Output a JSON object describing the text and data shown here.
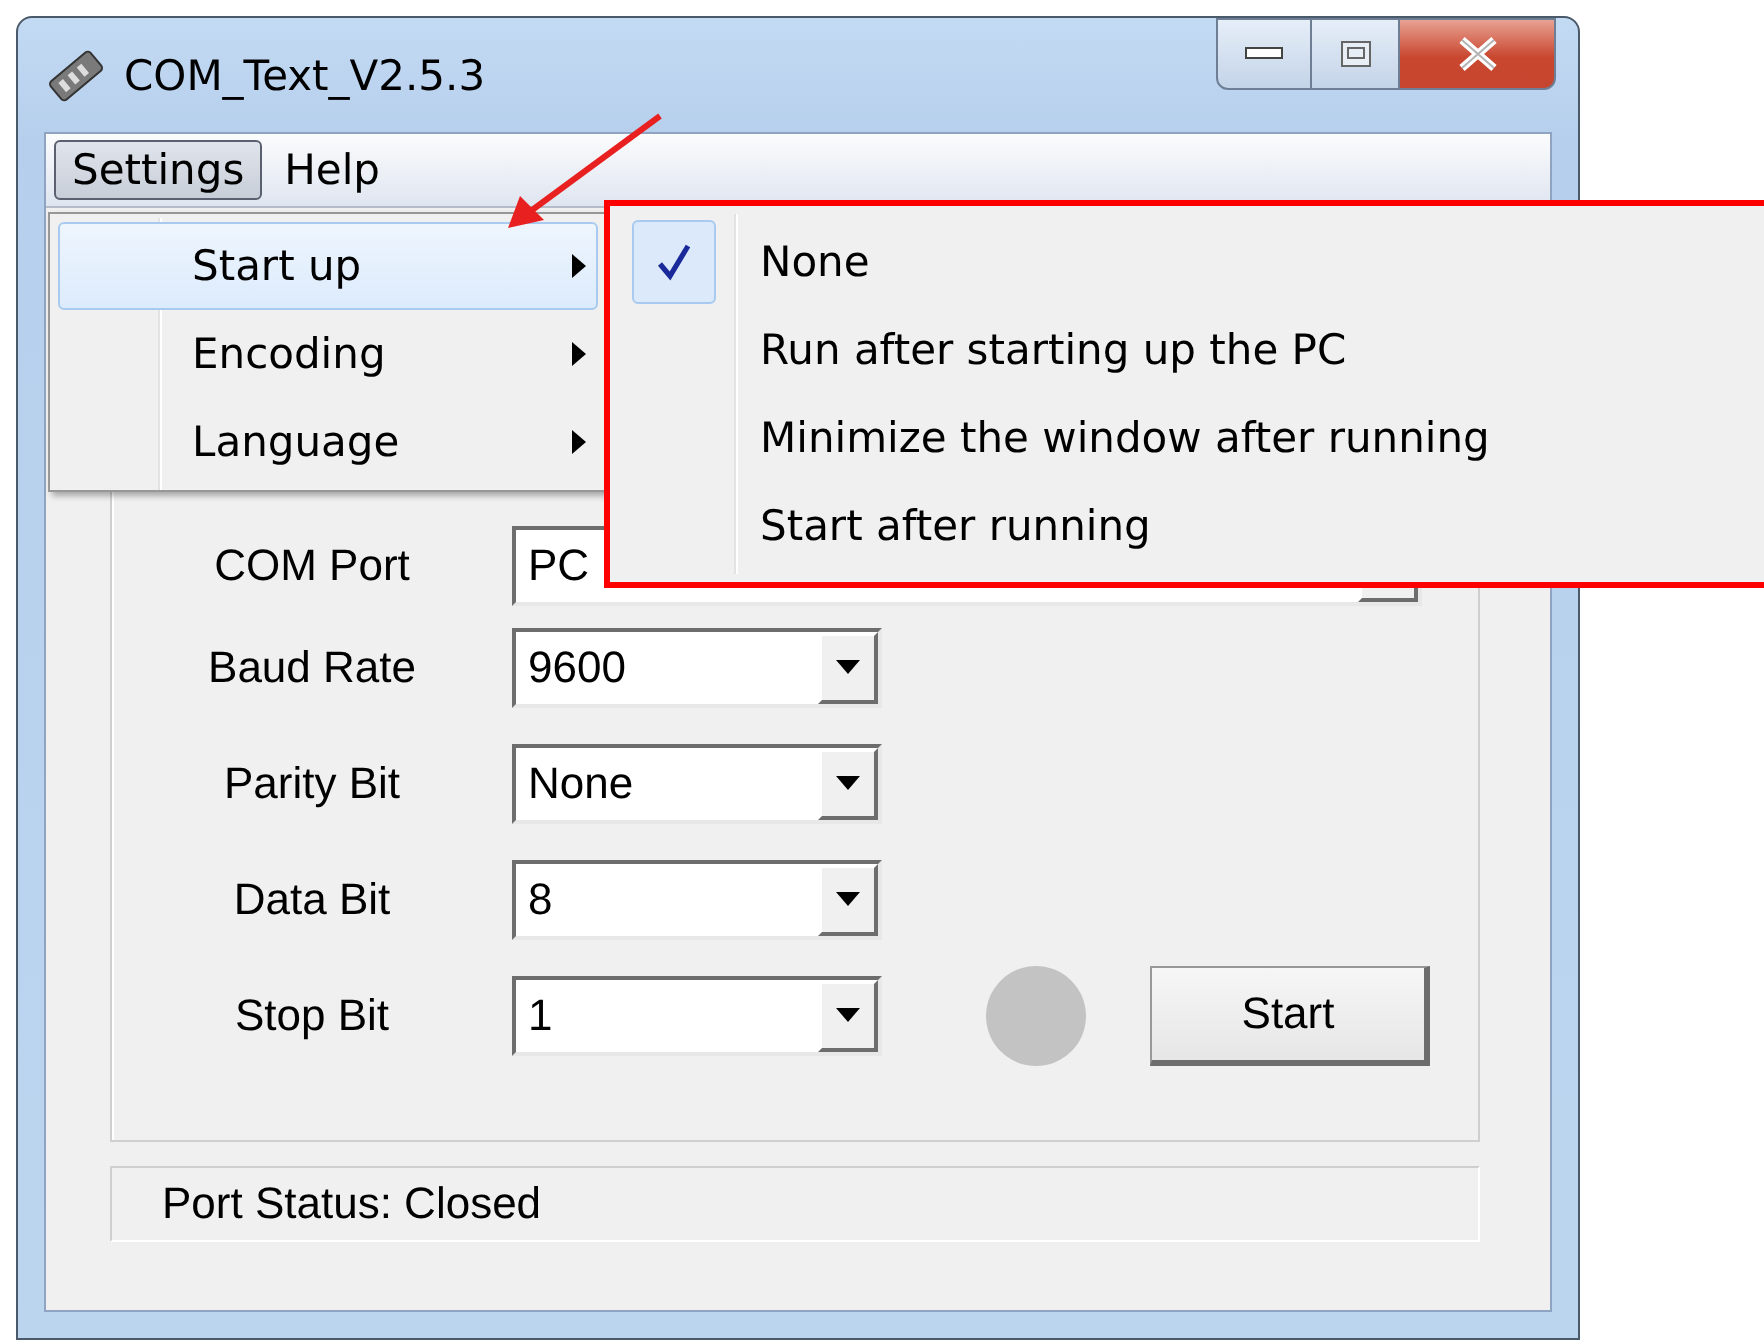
{
  "window": {
    "title": "COM_Text_V2.5.3"
  },
  "menu_bar": [
    {
      "label": "Settings",
      "selected": true
    },
    {
      "label": "Help",
      "selected": false
    }
  ],
  "settings_menu": [
    {
      "label": "Start up",
      "selected": true
    },
    {
      "label": "Encoding",
      "selected": false
    },
    {
      "label": "Language",
      "selected": false
    }
  ],
  "start_up_submenu": [
    {
      "label": "None",
      "checked": true
    },
    {
      "label": "Run after starting up the PC",
      "checked": false
    },
    {
      "label": "Minimize the window after running",
      "checked": false
    },
    {
      "label": "Start after running",
      "checked": false
    }
  ],
  "form": {
    "fields": [
      {
        "label": "COM Port",
        "value": "PC"
      },
      {
        "label": "Baud Rate",
        "value": "9600"
      },
      {
        "label": "Parity Bit",
        "value": "None"
      },
      {
        "label": "Data Bit",
        "value": "8"
      },
      {
        "label": "Stop Bit",
        "value": "1"
      }
    ],
    "status_lamp": {
      "on": false
    },
    "start_button": "Start"
  },
  "status_bar": "Port Status: Closed"
}
